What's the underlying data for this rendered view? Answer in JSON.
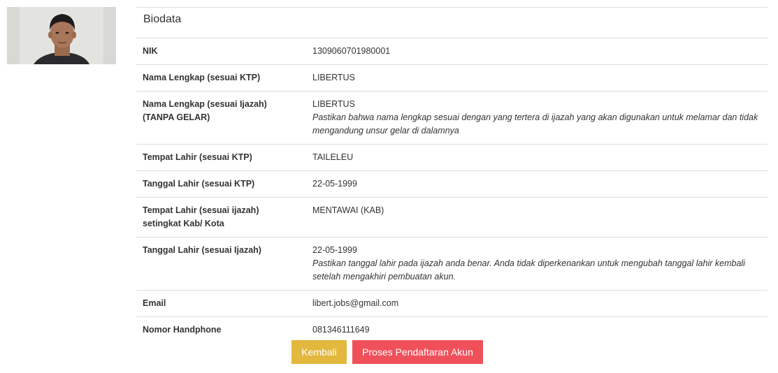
{
  "photo": {
    "alt": "profile photo"
  },
  "biodata": {
    "title": "Biodata",
    "rows": [
      {
        "label": "NIK",
        "value": "1309060701980001",
        "note": ""
      },
      {
        "label": "Nama Lengkap (sesuai KTP)",
        "value": "LIBERTUS",
        "note": ""
      },
      {
        "label": "Nama Lengkap (sesuai Ijazah)\n(TANPA GELAR)",
        "value": "LIBERTUS",
        "note": "Pastikan bahwa nama lengkap sesuai dengan yang tertera di ijazah yang akan digunakan untuk melamar dan tidak mengandung unsur gelar di dalamnya"
      },
      {
        "label": "Tempat Lahir (sesuai KTP)",
        "value": "TAILELEU",
        "note": ""
      },
      {
        "label": "Tanggal Lahir (sesuai KTP)",
        "value": "22-05-1999",
        "note": ""
      },
      {
        "label": "Tempat Lahir (sesuai ijazah)\nsetingkat Kab/ Kota",
        "value": "MENTAWAI (KAB)",
        "note": ""
      },
      {
        "label": "Tanggal Lahir (sesuai Ijazah)",
        "value": "22-05-1999",
        "note": "Pastikan tanggal lahir pada ijazah anda benar. Anda tidak diperkenankan untuk mengubah tanggal lahir kembali setelah mengakhiri pembuatan akun."
      },
      {
        "label": "Email",
        "value": "libert.jobs@gmail.com",
        "note": ""
      },
      {
        "label": "Nomor Handphone",
        "value": "081346111649",
        "note": ""
      }
    ]
  },
  "actions": {
    "back_label": "Kembali",
    "submit_label": "Proses Pendaftaran Akun"
  },
  "colors": {
    "back_button": "#e2b83d",
    "submit_button": "#f0505a",
    "border": "#dddddd",
    "text": "#333333"
  }
}
